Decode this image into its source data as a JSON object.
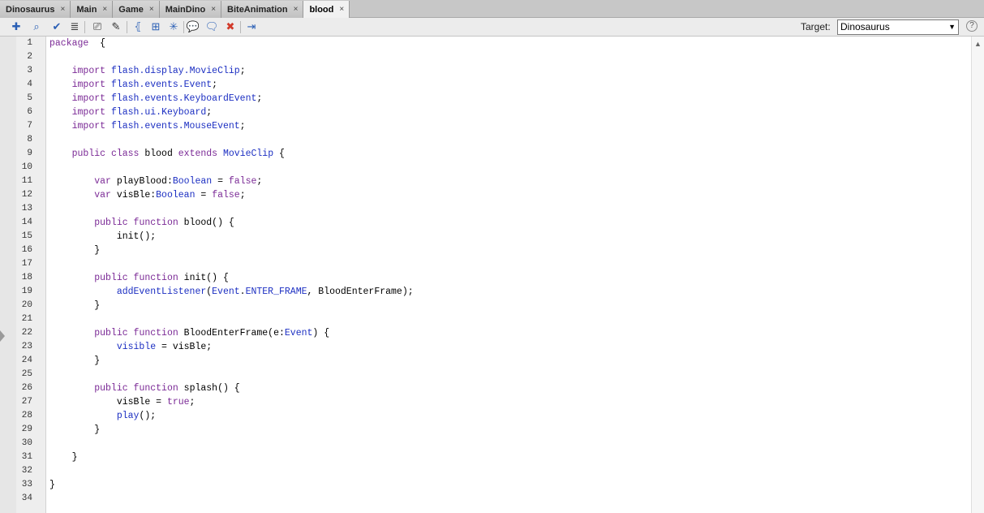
{
  "tabs": [
    {
      "label": "Dinosaurus",
      "active": false
    },
    {
      "label": "Main",
      "active": false
    },
    {
      "label": "Game",
      "active": false
    },
    {
      "label": "MainDino",
      "active": false
    },
    {
      "label": "BiteAnimation",
      "active": false
    },
    {
      "label": "blood",
      "active": true
    }
  ],
  "tab_close_glyph": "×",
  "toolbar": {
    "icons": [
      "add-statement-icon",
      "find-icon",
      "check-syntax-icon",
      "auto-format-icon",
      "code-hint-icon",
      "debug-options-icon",
      "collapse-between-braces-icon",
      "collapse-selection-icon",
      "expand-all-icon",
      "apply-block-comment-icon",
      "apply-line-comment-icon",
      "remove-comment-icon",
      "show-hide-toolbox-icon"
    ],
    "target_label": "Target:",
    "target_value": "Dinosaurus",
    "help_glyph": "?"
  },
  "editor": {
    "line_numbers": [
      "1",
      "2",
      "3",
      "4",
      "5",
      "6",
      "7",
      "8",
      "9",
      "10",
      "11",
      "12",
      "13",
      "14",
      "15",
      "16",
      "17",
      "18",
      "19",
      "20",
      "21",
      "22",
      "23",
      "24",
      "25",
      "26",
      "27",
      "28",
      "29",
      "30",
      "31",
      "32",
      "33",
      "34"
    ],
    "lines": [
      "package  {",
      "",
      "    import flash.display.MovieClip;",
      "    import flash.events.Event;",
      "    import flash.events.KeyboardEvent;",
      "    import flash.ui.Keyboard;",
      "    import flash.events.MouseEvent;",
      "",
      "    public class blood extends MovieClip {",
      "",
      "        var playBlood:Boolean = false;",
      "        var visBle:Boolean = false;",
      "",
      "        public function blood() {",
      "            init();",
      "        }",
      "",
      "        public function init() {",
      "            addEventListener(Event.ENTER_FRAME, BloodEnterFrame);",
      "        }",
      "",
      "        public function BloodEnterFrame(e:Event) {",
      "            visible = visBle;",
      "        }",
      "",
      "        public function splash() {",
      "            visBle = true;",
      "            play();",
      "        }",
      "",
      "    }",
      "",
      "}",
      ""
    ]
  },
  "colors": {
    "keyword": "#7b2a96",
    "identifier": "#1c2fc2"
  }
}
